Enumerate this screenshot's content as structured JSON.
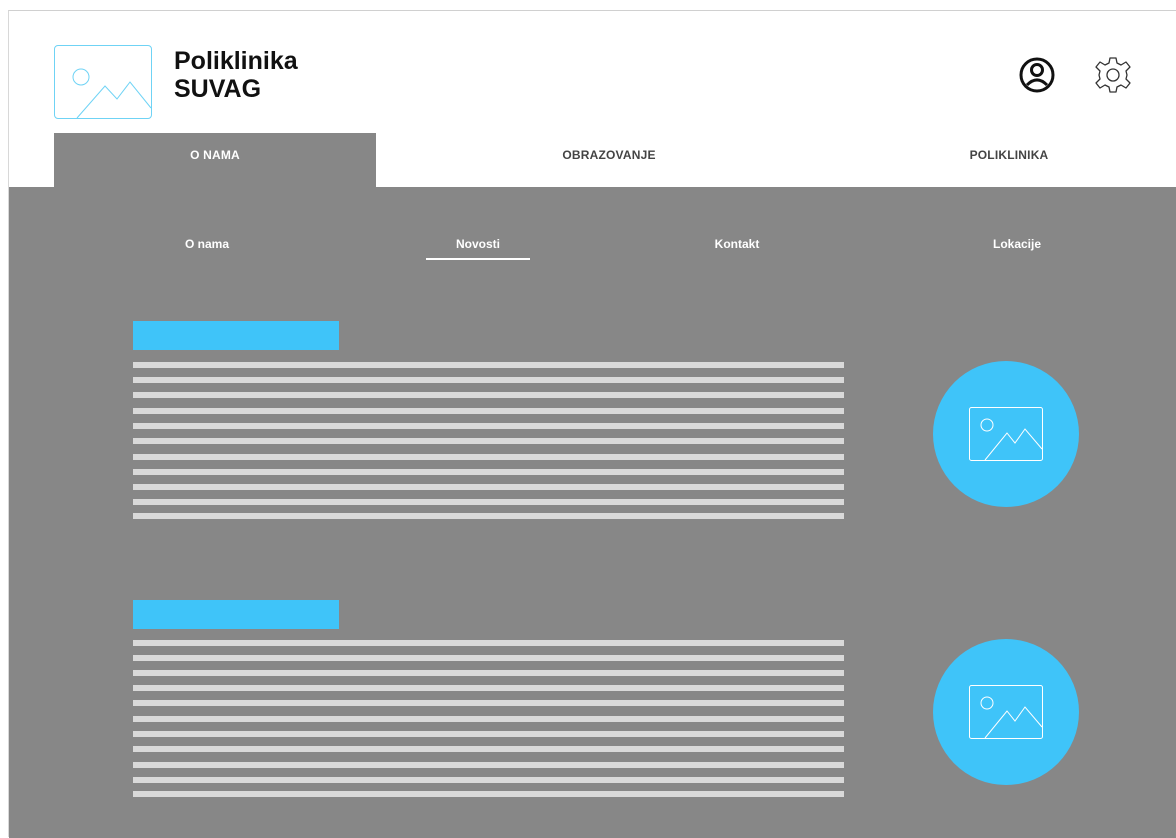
{
  "brand": {
    "line1": "Poliklinika",
    "line2": "SUVAG"
  },
  "header_icons": {
    "profile": "user-circle-icon",
    "settings": "gear-icon"
  },
  "main_tabs": [
    {
      "label": "O NAMA",
      "active": true
    },
    {
      "label": "OBRAZOVANJE",
      "active": false
    },
    {
      "label": "POLIKLINIKA",
      "active": false
    }
  ],
  "sub_nav": [
    {
      "label": "O nama",
      "active": false
    },
    {
      "label": "Novosti",
      "active": true
    },
    {
      "label": "Kontakt",
      "active": false
    },
    {
      "label": "Lokacije",
      "active": false
    }
  ],
  "news_items": [
    {
      "image": "image-placeholder-icon"
    },
    {
      "image": "image-placeholder-icon"
    }
  ],
  "colors": {
    "accent": "#3fc4f9",
    "panel": "#878787",
    "text_placeholder": "#d9d9d9"
  }
}
